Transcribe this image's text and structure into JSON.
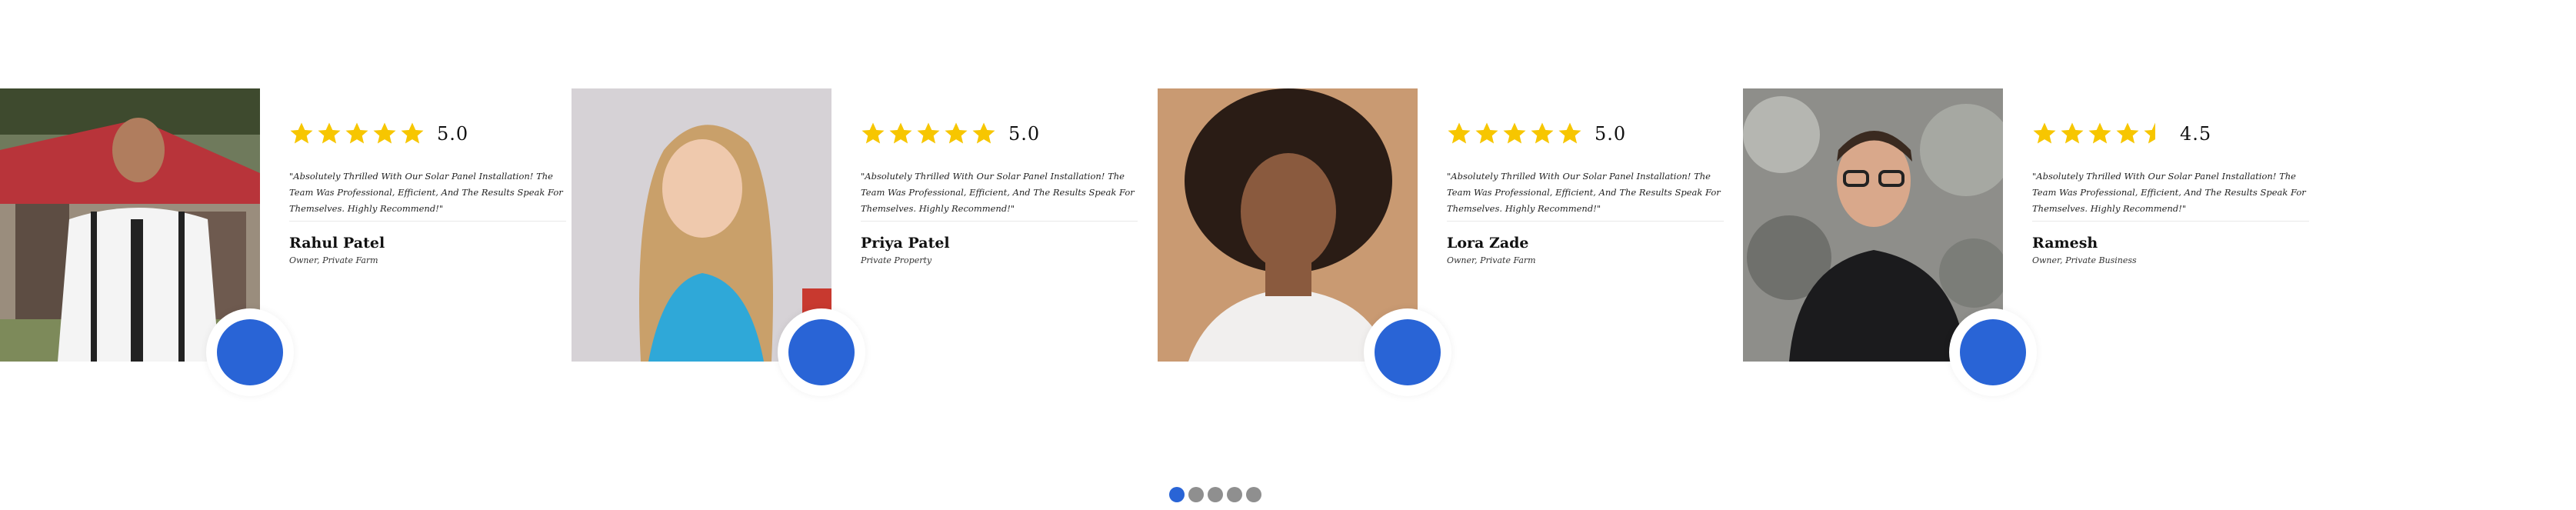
{
  "testimonials": [
    {
      "name": "Rahul Patel",
      "role": "Owner, Private Farm",
      "rating": 5,
      "rating_label": "5.0",
      "quote": "\"Absolutely Thrilled With Our Solar Panel Installation! The Team Was Professional, Efficient, And The Results Speak For Themselves. Highly Recommend!\""
    },
    {
      "name": "Priya Patel",
      "role": "Private Property",
      "rating": 5,
      "rating_label": "5.0",
      "quote": "\"Absolutely Thrilled With Our Solar Panel Installation! The Team Was Professional, Efficient, And The Results Speak For Themselves. Highly Recommend!\""
    },
    {
      "name": "Lora Zade",
      "role": "Owner, Private Farm",
      "rating": 5,
      "rating_label": "5.0",
      "quote": "\"Absolutely Thrilled With Our Solar Panel Installation! The Team Was Professional, Efficient, And The Results Speak For Themselves. Highly Recommend!\""
    },
    {
      "name": "Ramesh",
      "role": "Owner, Private Business",
      "rating": 4.5,
      "rating_label": "4.5",
      "quote": "\"Absolutely Thrilled With Our Solar Panel Installation! The Team Was Professional, Efficient, And The Results Speak For Themselves. Highly Recommend!\""
    }
  ],
  "pagination": {
    "count": 5,
    "active_index": 0
  },
  "colors": {
    "accent": "#2964d6",
    "star": "#f7c600",
    "dot_inactive": "#8f8f8f"
  },
  "icons": {
    "star": "star-icon",
    "badge": "quote-badge-icon"
  }
}
